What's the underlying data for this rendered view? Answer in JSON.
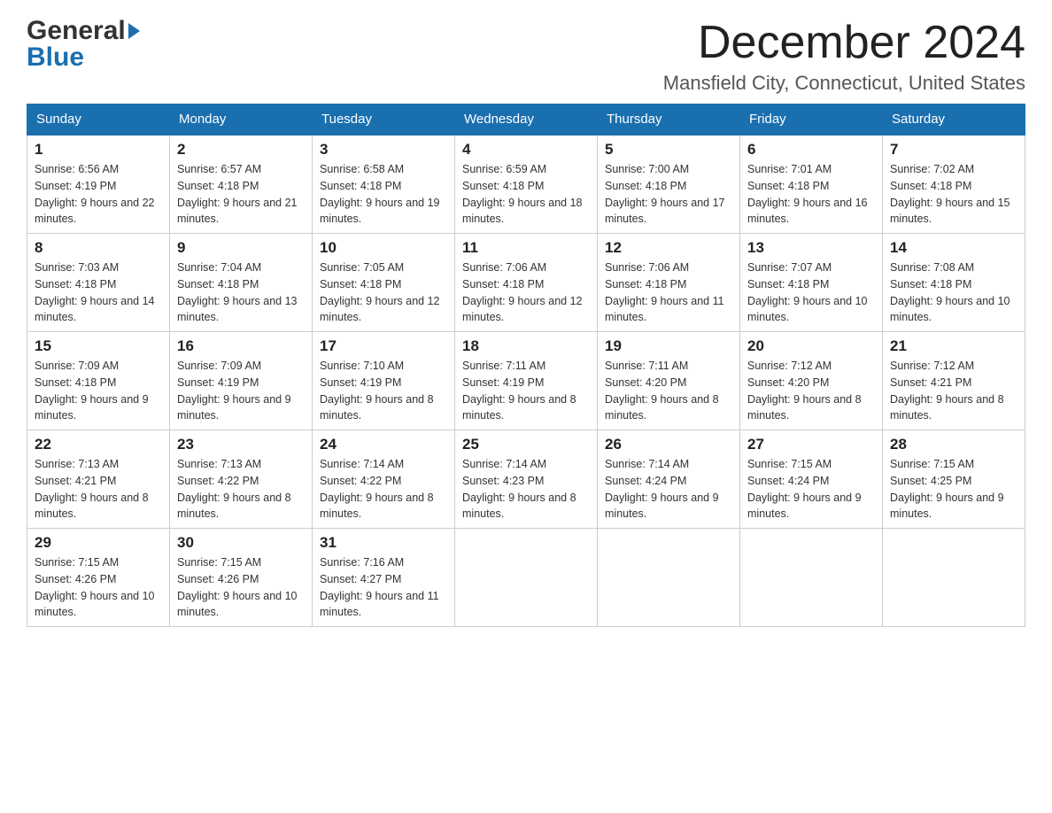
{
  "header": {
    "logo_general": "General",
    "logo_blue": "Blue",
    "month_title": "December 2024",
    "location": "Mansfield City, Connecticut, United States"
  },
  "days_of_week": [
    "Sunday",
    "Monday",
    "Tuesday",
    "Wednesday",
    "Thursday",
    "Friday",
    "Saturday"
  ],
  "weeks": [
    [
      {
        "day": "1",
        "sunrise": "Sunrise: 6:56 AM",
        "sunset": "Sunset: 4:19 PM",
        "daylight": "Daylight: 9 hours and 22 minutes."
      },
      {
        "day": "2",
        "sunrise": "Sunrise: 6:57 AM",
        "sunset": "Sunset: 4:18 PM",
        "daylight": "Daylight: 9 hours and 21 minutes."
      },
      {
        "day": "3",
        "sunrise": "Sunrise: 6:58 AM",
        "sunset": "Sunset: 4:18 PM",
        "daylight": "Daylight: 9 hours and 19 minutes."
      },
      {
        "day": "4",
        "sunrise": "Sunrise: 6:59 AM",
        "sunset": "Sunset: 4:18 PM",
        "daylight": "Daylight: 9 hours and 18 minutes."
      },
      {
        "day": "5",
        "sunrise": "Sunrise: 7:00 AM",
        "sunset": "Sunset: 4:18 PM",
        "daylight": "Daylight: 9 hours and 17 minutes."
      },
      {
        "day": "6",
        "sunrise": "Sunrise: 7:01 AM",
        "sunset": "Sunset: 4:18 PM",
        "daylight": "Daylight: 9 hours and 16 minutes."
      },
      {
        "day": "7",
        "sunrise": "Sunrise: 7:02 AM",
        "sunset": "Sunset: 4:18 PM",
        "daylight": "Daylight: 9 hours and 15 minutes."
      }
    ],
    [
      {
        "day": "8",
        "sunrise": "Sunrise: 7:03 AM",
        "sunset": "Sunset: 4:18 PM",
        "daylight": "Daylight: 9 hours and 14 minutes."
      },
      {
        "day": "9",
        "sunrise": "Sunrise: 7:04 AM",
        "sunset": "Sunset: 4:18 PM",
        "daylight": "Daylight: 9 hours and 13 minutes."
      },
      {
        "day": "10",
        "sunrise": "Sunrise: 7:05 AM",
        "sunset": "Sunset: 4:18 PM",
        "daylight": "Daylight: 9 hours and 12 minutes."
      },
      {
        "day": "11",
        "sunrise": "Sunrise: 7:06 AM",
        "sunset": "Sunset: 4:18 PM",
        "daylight": "Daylight: 9 hours and 12 minutes."
      },
      {
        "day": "12",
        "sunrise": "Sunrise: 7:06 AM",
        "sunset": "Sunset: 4:18 PM",
        "daylight": "Daylight: 9 hours and 11 minutes."
      },
      {
        "day": "13",
        "sunrise": "Sunrise: 7:07 AM",
        "sunset": "Sunset: 4:18 PM",
        "daylight": "Daylight: 9 hours and 10 minutes."
      },
      {
        "day": "14",
        "sunrise": "Sunrise: 7:08 AM",
        "sunset": "Sunset: 4:18 PM",
        "daylight": "Daylight: 9 hours and 10 minutes."
      }
    ],
    [
      {
        "day": "15",
        "sunrise": "Sunrise: 7:09 AM",
        "sunset": "Sunset: 4:18 PM",
        "daylight": "Daylight: 9 hours and 9 minutes."
      },
      {
        "day": "16",
        "sunrise": "Sunrise: 7:09 AM",
        "sunset": "Sunset: 4:19 PM",
        "daylight": "Daylight: 9 hours and 9 minutes."
      },
      {
        "day": "17",
        "sunrise": "Sunrise: 7:10 AM",
        "sunset": "Sunset: 4:19 PM",
        "daylight": "Daylight: 9 hours and 8 minutes."
      },
      {
        "day": "18",
        "sunrise": "Sunrise: 7:11 AM",
        "sunset": "Sunset: 4:19 PM",
        "daylight": "Daylight: 9 hours and 8 minutes."
      },
      {
        "day": "19",
        "sunrise": "Sunrise: 7:11 AM",
        "sunset": "Sunset: 4:20 PM",
        "daylight": "Daylight: 9 hours and 8 minutes."
      },
      {
        "day": "20",
        "sunrise": "Sunrise: 7:12 AM",
        "sunset": "Sunset: 4:20 PM",
        "daylight": "Daylight: 9 hours and 8 minutes."
      },
      {
        "day": "21",
        "sunrise": "Sunrise: 7:12 AM",
        "sunset": "Sunset: 4:21 PM",
        "daylight": "Daylight: 9 hours and 8 minutes."
      }
    ],
    [
      {
        "day": "22",
        "sunrise": "Sunrise: 7:13 AM",
        "sunset": "Sunset: 4:21 PM",
        "daylight": "Daylight: 9 hours and 8 minutes."
      },
      {
        "day": "23",
        "sunrise": "Sunrise: 7:13 AM",
        "sunset": "Sunset: 4:22 PM",
        "daylight": "Daylight: 9 hours and 8 minutes."
      },
      {
        "day": "24",
        "sunrise": "Sunrise: 7:14 AM",
        "sunset": "Sunset: 4:22 PM",
        "daylight": "Daylight: 9 hours and 8 minutes."
      },
      {
        "day": "25",
        "sunrise": "Sunrise: 7:14 AM",
        "sunset": "Sunset: 4:23 PM",
        "daylight": "Daylight: 9 hours and 8 minutes."
      },
      {
        "day": "26",
        "sunrise": "Sunrise: 7:14 AM",
        "sunset": "Sunset: 4:24 PM",
        "daylight": "Daylight: 9 hours and 9 minutes."
      },
      {
        "day": "27",
        "sunrise": "Sunrise: 7:15 AM",
        "sunset": "Sunset: 4:24 PM",
        "daylight": "Daylight: 9 hours and 9 minutes."
      },
      {
        "day": "28",
        "sunrise": "Sunrise: 7:15 AM",
        "sunset": "Sunset: 4:25 PM",
        "daylight": "Daylight: 9 hours and 9 minutes."
      }
    ],
    [
      {
        "day": "29",
        "sunrise": "Sunrise: 7:15 AM",
        "sunset": "Sunset: 4:26 PM",
        "daylight": "Daylight: 9 hours and 10 minutes."
      },
      {
        "day": "30",
        "sunrise": "Sunrise: 7:15 AM",
        "sunset": "Sunset: 4:26 PM",
        "daylight": "Daylight: 9 hours and 10 minutes."
      },
      {
        "day": "31",
        "sunrise": "Sunrise: 7:16 AM",
        "sunset": "Sunset: 4:27 PM",
        "daylight": "Daylight: 9 hours and 11 minutes."
      },
      null,
      null,
      null,
      null
    ]
  ]
}
